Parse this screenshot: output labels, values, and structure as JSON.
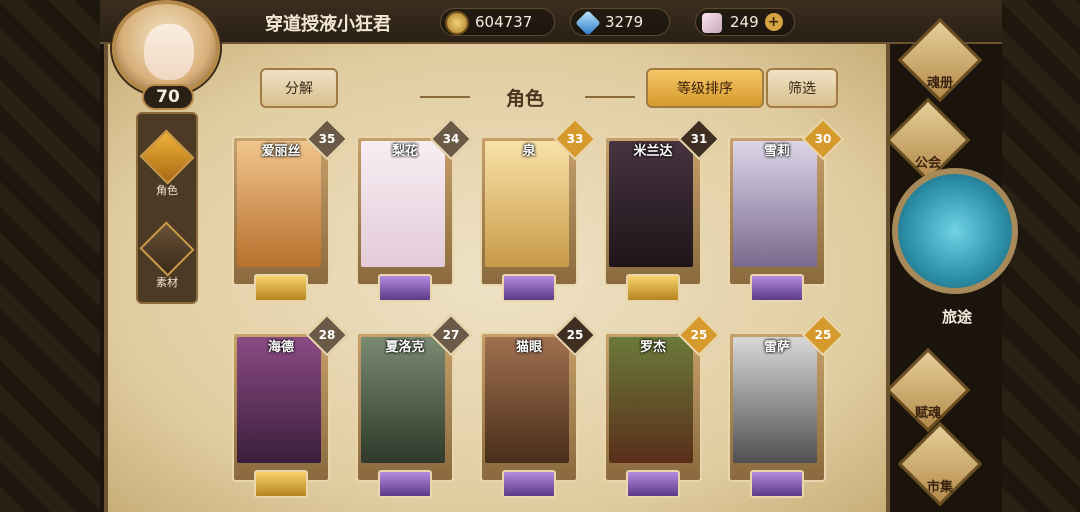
{
  "player": {
    "name": "穿道授液小狂君",
    "level": "70"
  },
  "resources": [
    {
      "name": "gold",
      "value": "604737"
    },
    {
      "name": "gem",
      "value": "3279"
    },
    {
      "name": "crystal",
      "value": "249"
    }
  ],
  "left_tabs": [
    {
      "label": "角色",
      "icon": "role-icon",
      "selected": true
    },
    {
      "label": "素材",
      "icon": "material-icon",
      "selected": false
    }
  ],
  "header": {
    "title": "角色",
    "decompose_label": "分解",
    "sort_label": "等级排序",
    "filter_label": "筛选"
  },
  "characters": [
    {
      "name": "爱丽丝",
      "level": "35",
      "rank": "gold"
    },
    {
      "name": "梨花",
      "level": "34",
      "rank": "purple"
    },
    {
      "name": "泉",
      "level": "33",
      "rank": "purple"
    },
    {
      "name": "米兰达",
      "level": "31",
      "rank": "gold"
    },
    {
      "name": "雪莉",
      "level": "30",
      "rank": "purple"
    },
    {
      "name": "海德",
      "level": "28",
      "rank": "gold"
    },
    {
      "name": "夏洛克",
      "level": "27",
      "rank": "purple"
    },
    {
      "name": "猫眼",
      "level": "25",
      "rank": "purple"
    },
    {
      "name": "罗杰",
      "level": "25",
      "rank": "purple"
    },
    {
      "name": "雷萨",
      "level": "25",
      "rank": "purple"
    }
  ],
  "right_menu": {
    "soul_label": "魂册",
    "guild_label": "公会",
    "journey_label": "旅途",
    "talent_label": "赋魂",
    "market_label": "市集"
  }
}
